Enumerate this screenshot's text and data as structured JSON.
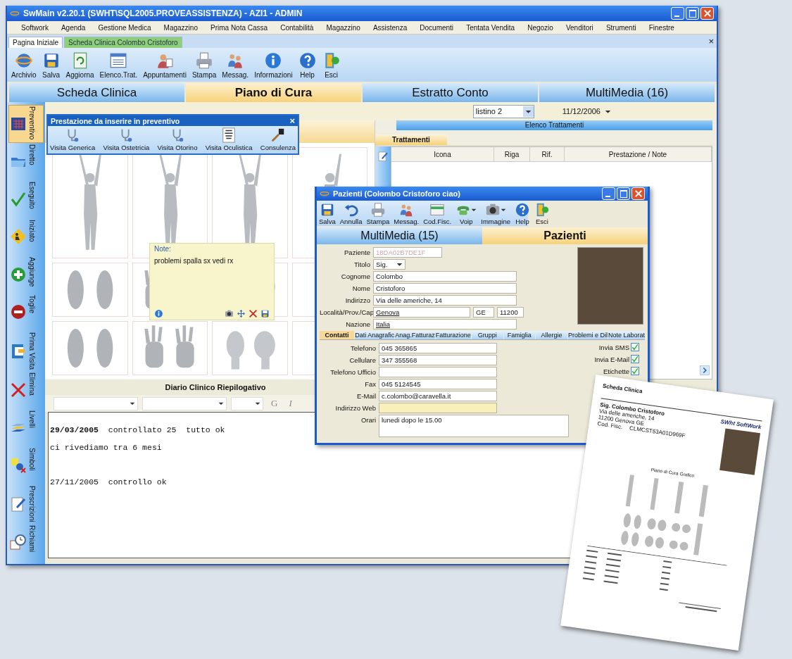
{
  "window": {
    "title": "SwMain v2.20.1 (SWHT\\SQL2005.PROVEASSISTENZA) - AZI1 - ADMIN"
  },
  "menu": [
    "Softwork",
    "Agenda",
    "Gestione Medica",
    "Magazzino",
    "Prima Nota Cassa",
    "Contabilità",
    "Magazzino",
    "Assistenza",
    "Documenti",
    "Tentata Vendita",
    "Negozio",
    "Venditori",
    "Strumenti",
    "Finestre"
  ],
  "document_tabs": [
    {
      "label": "Pagina Iniziale",
      "selected": false
    },
    {
      "label": "Scheda Clinica Colombo Cristoforo",
      "selected": true
    }
  ],
  "tab_bar_close": "×",
  "toolbar": [
    "Archivio",
    "Salva",
    "Aggiorna",
    "Elenco.Trat.",
    "Appuntamenti",
    "Stampa",
    "Messag.",
    "Informazioni",
    "Help",
    "Esci"
  ],
  "main_tabs": [
    {
      "label": "Scheda Clinica",
      "selected": false
    },
    {
      "label": "Piano di Cura",
      "selected": true
    },
    {
      "label": "Estratto Conto",
      "selected": false
    },
    {
      "label": "MultiMedia (16)",
      "selected": false
    }
  ],
  "sidebar": [
    {
      "label": "Preventivo",
      "selected": true
    },
    {
      "label": "Diretto",
      "selected": false
    },
    {
      "label": "Eseguito",
      "selected": false
    },
    {
      "label": "Iniziato",
      "selected": false
    },
    {
      "label": "Aggiunge",
      "selected": false
    },
    {
      "label": "Toglie",
      "selected": false
    },
    {
      "label": "Prima Visita",
      "selected": false
    },
    {
      "label": "Elimina",
      "selected": false
    },
    {
      "label": "Livelli",
      "selected": false
    },
    {
      "label": "Simboli",
      "selected": false
    },
    {
      "label": "Prescrizioni",
      "selected": false
    },
    {
      "label": "Richiami",
      "selected": false
    }
  ],
  "price_list": {
    "value": "listino 2"
  },
  "date": {
    "value": "11/12/2006"
  },
  "treatments_panel": {
    "title": "Elenco Trattamenti",
    "tab": "Trattamenti",
    "columns": [
      "Icona",
      "Riga",
      "Rif.",
      "Prestazione / Note"
    ]
  },
  "services_popup": {
    "title": "Prestazione da inserire in preventivo",
    "close": "×",
    "items": [
      "Visita Generica",
      "Visita Ostetricia",
      "Visita  Otorino",
      "Visita Oculistica",
      "Consulenza"
    ]
  },
  "note_popup": {
    "label": "Note:",
    "text": "problemi spalla sx vedi rx"
  },
  "diary": {
    "title": "Diario Clinico Riepilogativo",
    "format_buttons": [
      "G",
      "I"
    ],
    "lines": [
      {
        "text": "**29/03/2005**  controllato 25  tutto ok",
        "spaced": false
      },
      {
        "text": "ci rivediamo tra 6 mesi",
        "spaced": false
      },
      {
        "text": "27/11/2005  controllo ok",
        "spaced": true
      }
    ]
  },
  "patient_window": {
    "title": "Pazienti (Colombo Cristoforo ciao)",
    "toolbar": [
      {
        "label": "Salva",
        "dropdown": false
      },
      {
        "label": "Annulla",
        "dropdown": false
      },
      {
        "label": "Stampa",
        "dropdown": false
      },
      {
        "label": "Messag.",
        "dropdown": false
      },
      {
        "label": "Cod.Fisc.",
        "dropdown": false
      },
      {
        "label": "Voip",
        "dropdown": true
      },
      {
        "label": "Immagine",
        "dropdown": true
      },
      {
        "label": "Help",
        "dropdown": false
      },
      {
        "label": "Esci",
        "dropdown": false
      }
    ],
    "tabs": [
      {
        "label": "MultiMedia (15)",
        "selected": false
      },
      {
        "label": "Pazienti",
        "selected": true
      }
    ],
    "fields": [
      {
        "label": "Paziente",
        "value": "18DA02B7DE1F",
        "kind": "readonly"
      },
      {
        "label": "Titolo",
        "value": "Sig.",
        "kind": "select"
      },
      {
        "label": "Cognome",
        "value": "Colombo",
        "kind": "text"
      },
      {
        "label": "Nome",
        "value": "Cristoforo",
        "kind": "text"
      },
      {
        "label": "Indirizzo",
        "value": "Via delle americhe, 14",
        "kind": "text"
      },
      {
        "label": "Località/Prov./Cap",
        "value": "Genova",
        "province": "GE",
        "postcode": "11200",
        "kind": "city"
      },
      {
        "label": "Nazione",
        "value": "Italia",
        "kind": "link"
      }
    ],
    "subtabs": [
      {
        "label": "Contatti",
        "selected": true
      },
      {
        "label": "Dati Anagrafic",
        "selected": false
      },
      {
        "label": "Anag.Fatturaz",
        "selected": false
      },
      {
        "label": "Fatturazione",
        "selected": false
      },
      {
        "label": "Gruppi",
        "selected": false
      },
      {
        "label": "Famiglia",
        "selected": false
      },
      {
        "label": "Allergie",
        "selected": false
      },
      {
        "label": "Problemi  e Dil",
        "selected": false
      },
      {
        "label": "Note Laborat",
        "selected": false
      }
    ],
    "contacts": [
      {
        "label": "Telefono",
        "value": "045 365865",
        "highlighted": false
      },
      {
        "label": "Cellulare",
        "value": "347 355568",
        "highlighted": false
      },
      {
        "label": "Telefono Ufficio",
        "highlighted": false
      },
      {
        "label": "Fax",
        "value": "045 5124545",
        "highlighted": false
      },
      {
        "label": "E-Mail",
        "value": "c.colombo@caravella.it",
        "highlighted": false
      },
      {
        "label": "Indirizzo Web",
        "highlighted": true
      },
      {
        "label": "Orari",
        "value": "lunedi dopo le 15.00",
        "highlighted": false
      }
    ],
    "options": [
      {
        "label": "Invia SMS",
        "checked": true
      },
      {
        "label": "Invia E-Mail",
        "checked": true
      },
      {
        "label": "Etichette",
        "checked": true
      }
    ]
  },
  "printout": {
    "title": "Scheda Clinica",
    "company": "SWht  SoftWork",
    "patient": "Sig. Colombo Cristoforo",
    "address_lines": [
      "Via delle americhe, 14",
      "11200 Genova GE"
    ],
    "tax_code_label": "Cod. Fisc.",
    "tax_code": "CLMCST53A01D969F",
    "section_title": "Piano di Cura Grafico"
  }
}
